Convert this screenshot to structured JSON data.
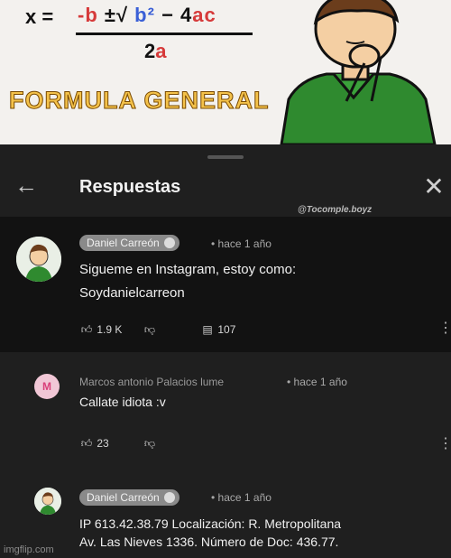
{
  "banner": {
    "formula_x": "x =",
    "formula_numerator_b": "-b",
    "formula_numerator_pm": "±√",
    "formula_numerator_b2": "b²",
    "formula_numerator_minus": "−",
    "formula_numerator_4": "4",
    "formula_numerator_ac": "ac",
    "formula_denominator_2": "2",
    "formula_denominator_a": "a",
    "title": "FORMULA GENERAL",
    "colors": {
      "formula_red": "#d63a3a",
      "formula_blue": "#3a5fd6",
      "title_fill": "#f4c24a",
      "shirt_green": "#2f8a2f"
    }
  },
  "panel": {
    "back_icon": "arrow-left-icon",
    "title": "Respuestas",
    "close_icon": "close-icon",
    "watermark": "@Tocomple.boyz"
  },
  "comments": [
    {
      "author": "Daniel Carreón",
      "time": "• hace 1 año",
      "line1": "Sigueme en Instagram, estoy como:",
      "line2": "Soydanielcarreon",
      "likes": "1.9 K",
      "replies": "107"
    },
    {
      "avatar_letter": "M",
      "author": "Marcos antonio Palacios lume",
      "time": "• hace 1 año",
      "line1": "Callate idiota :v",
      "likes": "23"
    },
    {
      "author": "Daniel Carreón",
      "time": "• hace 1 año",
      "line1": "IP 613.42.38.79 Localización: R. Metropolitana",
      "line2": "Av. Las Nieves 1336.  Número de Doc: 436.77."
    }
  ],
  "footer": {
    "imgflip": "imgflip.com"
  }
}
